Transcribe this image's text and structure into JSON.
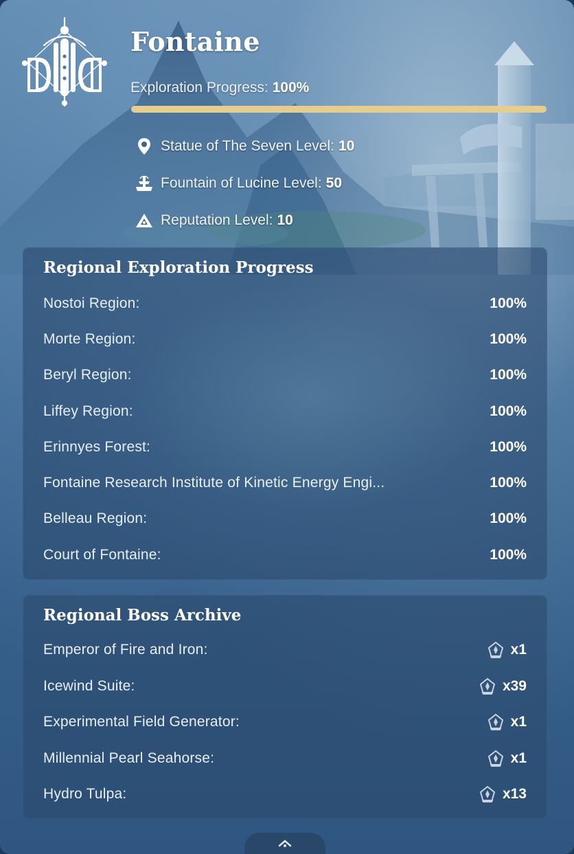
{
  "header": {
    "region_name": "Fontaine",
    "exploration_label": "Exploration Progress:",
    "exploration_value": "100%",
    "exploration_fraction": 1.0,
    "emblem_icon": "fontaine-emblem-icon",
    "progress_color": "#e5cd8f"
  },
  "stats": [
    {
      "icon": "map-pin-icon",
      "label": "Statue of The Seven Level:",
      "value": "10"
    },
    {
      "icon": "fountain-icon",
      "label": "Fountain of Lucine Level:",
      "value": "50"
    },
    {
      "icon": "reputation-icon",
      "label": "Reputation Level:",
      "value": "10"
    }
  ],
  "regional_exploration": {
    "title": "Regional Exploration Progress",
    "rows": [
      {
        "name": "Nostoi Region:",
        "value": "100%"
      },
      {
        "name": "Morte Region:",
        "value": "100%"
      },
      {
        "name": "Beryl Region:",
        "value": "100%"
      },
      {
        "name": "Liffey Region:",
        "value": "100%"
      },
      {
        "name": "Erinnyes Forest:",
        "value": "100%"
      },
      {
        "name": "Fontaine Research Institute of Kinetic Energy Engi...",
        "value": "100%"
      },
      {
        "name": "Belleau Region:",
        "value": "100%"
      },
      {
        "name": "Court of Fontaine:",
        "value": "100%"
      }
    ]
  },
  "boss_archive": {
    "title": "Regional Boss Archive",
    "rows": [
      {
        "name": "Emperor of Fire and Iron:",
        "icon": "boss-crystal-icon",
        "value": "x1"
      },
      {
        "name": "Icewind Suite:",
        "icon": "boss-crystal-icon",
        "value": "x39"
      },
      {
        "name": "Experimental Field Generator:",
        "icon": "boss-crystal-icon",
        "value": "x1"
      },
      {
        "name": "Millennial Pearl Seahorse:",
        "icon": "boss-crystal-icon",
        "value": "x1"
      },
      {
        "name": "Hydro Tulpa:",
        "icon": "boss-crystal-icon",
        "value": "x13"
      }
    ]
  },
  "footer": {
    "collapse_icon": "chevron-up-icon"
  }
}
